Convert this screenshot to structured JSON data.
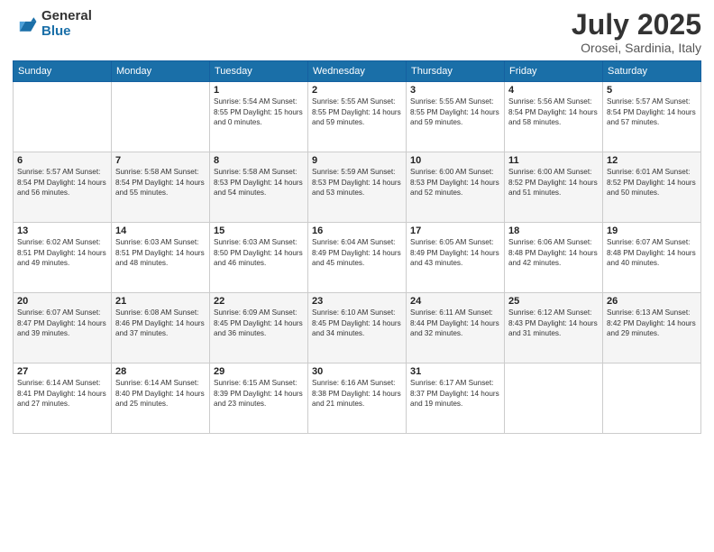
{
  "logo": {
    "general": "General",
    "blue": "Blue"
  },
  "header": {
    "month": "July 2025",
    "location": "Orosei, Sardinia, Italy"
  },
  "days_of_week": [
    "Sunday",
    "Monday",
    "Tuesday",
    "Wednesday",
    "Thursday",
    "Friday",
    "Saturday"
  ],
  "weeks": [
    [
      {
        "day": "",
        "info": ""
      },
      {
        "day": "",
        "info": ""
      },
      {
        "day": "1",
        "info": "Sunrise: 5:54 AM\nSunset: 8:55 PM\nDaylight: 15 hours\nand 0 minutes."
      },
      {
        "day": "2",
        "info": "Sunrise: 5:55 AM\nSunset: 8:55 PM\nDaylight: 14 hours\nand 59 minutes."
      },
      {
        "day": "3",
        "info": "Sunrise: 5:55 AM\nSunset: 8:55 PM\nDaylight: 14 hours\nand 59 minutes."
      },
      {
        "day": "4",
        "info": "Sunrise: 5:56 AM\nSunset: 8:54 PM\nDaylight: 14 hours\nand 58 minutes."
      },
      {
        "day": "5",
        "info": "Sunrise: 5:57 AM\nSunset: 8:54 PM\nDaylight: 14 hours\nand 57 minutes."
      }
    ],
    [
      {
        "day": "6",
        "info": "Sunrise: 5:57 AM\nSunset: 8:54 PM\nDaylight: 14 hours\nand 56 minutes."
      },
      {
        "day": "7",
        "info": "Sunrise: 5:58 AM\nSunset: 8:54 PM\nDaylight: 14 hours\nand 55 minutes."
      },
      {
        "day": "8",
        "info": "Sunrise: 5:58 AM\nSunset: 8:53 PM\nDaylight: 14 hours\nand 54 minutes."
      },
      {
        "day": "9",
        "info": "Sunrise: 5:59 AM\nSunset: 8:53 PM\nDaylight: 14 hours\nand 53 minutes."
      },
      {
        "day": "10",
        "info": "Sunrise: 6:00 AM\nSunset: 8:53 PM\nDaylight: 14 hours\nand 52 minutes."
      },
      {
        "day": "11",
        "info": "Sunrise: 6:00 AM\nSunset: 8:52 PM\nDaylight: 14 hours\nand 51 minutes."
      },
      {
        "day": "12",
        "info": "Sunrise: 6:01 AM\nSunset: 8:52 PM\nDaylight: 14 hours\nand 50 minutes."
      }
    ],
    [
      {
        "day": "13",
        "info": "Sunrise: 6:02 AM\nSunset: 8:51 PM\nDaylight: 14 hours\nand 49 minutes."
      },
      {
        "day": "14",
        "info": "Sunrise: 6:03 AM\nSunset: 8:51 PM\nDaylight: 14 hours\nand 48 minutes."
      },
      {
        "day": "15",
        "info": "Sunrise: 6:03 AM\nSunset: 8:50 PM\nDaylight: 14 hours\nand 46 minutes."
      },
      {
        "day": "16",
        "info": "Sunrise: 6:04 AM\nSunset: 8:49 PM\nDaylight: 14 hours\nand 45 minutes."
      },
      {
        "day": "17",
        "info": "Sunrise: 6:05 AM\nSunset: 8:49 PM\nDaylight: 14 hours\nand 43 minutes."
      },
      {
        "day": "18",
        "info": "Sunrise: 6:06 AM\nSunset: 8:48 PM\nDaylight: 14 hours\nand 42 minutes."
      },
      {
        "day": "19",
        "info": "Sunrise: 6:07 AM\nSunset: 8:48 PM\nDaylight: 14 hours\nand 40 minutes."
      }
    ],
    [
      {
        "day": "20",
        "info": "Sunrise: 6:07 AM\nSunset: 8:47 PM\nDaylight: 14 hours\nand 39 minutes."
      },
      {
        "day": "21",
        "info": "Sunrise: 6:08 AM\nSunset: 8:46 PM\nDaylight: 14 hours\nand 37 minutes."
      },
      {
        "day": "22",
        "info": "Sunrise: 6:09 AM\nSunset: 8:45 PM\nDaylight: 14 hours\nand 36 minutes."
      },
      {
        "day": "23",
        "info": "Sunrise: 6:10 AM\nSunset: 8:45 PM\nDaylight: 14 hours\nand 34 minutes."
      },
      {
        "day": "24",
        "info": "Sunrise: 6:11 AM\nSunset: 8:44 PM\nDaylight: 14 hours\nand 32 minutes."
      },
      {
        "day": "25",
        "info": "Sunrise: 6:12 AM\nSunset: 8:43 PM\nDaylight: 14 hours\nand 31 minutes."
      },
      {
        "day": "26",
        "info": "Sunrise: 6:13 AM\nSunset: 8:42 PM\nDaylight: 14 hours\nand 29 minutes."
      }
    ],
    [
      {
        "day": "27",
        "info": "Sunrise: 6:14 AM\nSunset: 8:41 PM\nDaylight: 14 hours\nand 27 minutes."
      },
      {
        "day": "28",
        "info": "Sunrise: 6:14 AM\nSunset: 8:40 PM\nDaylight: 14 hours\nand 25 minutes."
      },
      {
        "day": "29",
        "info": "Sunrise: 6:15 AM\nSunset: 8:39 PM\nDaylight: 14 hours\nand 23 minutes."
      },
      {
        "day": "30",
        "info": "Sunrise: 6:16 AM\nSunset: 8:38 PM\nDaylight: 14 hours\nand 21 minutes."
      },
      {
        "day": "31",
        "info": "Sunrise: 6:17 AM\nSunset: 8:37 PM\nDaylight: 14 hours\nand 19 minutes."
      },
      {
        "day": "",
        "info": ""
      },
      {
        "day": "",
        "info": ""
      }
    ]
  ]
}
